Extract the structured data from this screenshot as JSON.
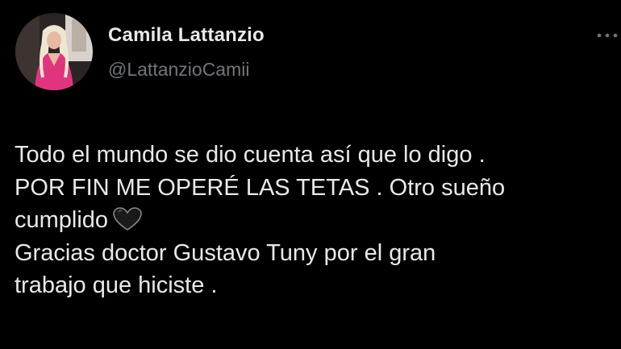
{
  "author": {
    "display_name": "Camila Lattanzio",
    "handle": "@LattanzioCamii",
    "avatar_icon": "profile-avatar"
  },
  "menu": {
    "icon": "more-options-icon"
  },
  "tweet": {
    "lines": [
      "Todo el mundo se dio cuenta así que lo digo .",
      "POR FIN ME OPERÉ LAS TETAS . Otro sueño",
      "cumplido",
      "Gracias doctor Gustavo Tuny por el gran",
      "trabajo que hiciste ."
    ],
    "emoji_icon": "black-heart-icon"
  },
  "colors": {
    "background": "#000000",
    "primary_text": "#e7e9ea",
    "secondary_text": "#71767b"
  }
}
